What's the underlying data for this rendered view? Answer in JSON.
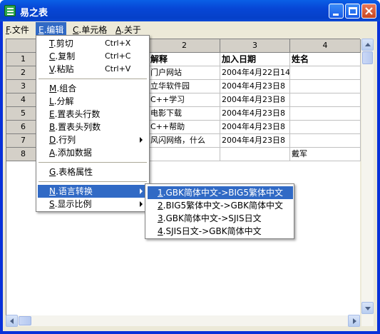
{
  "window": {
    "title": "易之表"
  },
  "menubar": [
    {
      "key": "F",
      "label": "文件"
    },
    {
      "key": "E",
      "label": "编辑"
    },
    {
      "key": "C",
      "label": "单元格"
    },
    {
      "key": "A",
      "label": "关于"
    }
  ],
  "grid": {
    "column_headers": [
      "2",
      "3",
      "4"
    ],
    "row_headers": [
      "1",
      "2",
      "3",
      "4",
      "5",
      "6",
      "7",
      "8"
    ],
    "rows": [
      [
        "解释",
        "加入日期",
        "姓名"
      ],
      [
        "门户网站",
        "2004年4月22日14",
        ""
      ],
      [
        "立华软件园",
        "2004年4月23日8",
        ""
      ],
      [
        "C++学习",
        "2004年4月23日8",
        ""
      ],
      [
        "电影下载",
        "2004年4月23日8",
        ""
      ],
      [
        "C++帮助",
        "2004年4月23日8",
        ""
      ],
      [
        "风闪网络，什么",
        "2004年4月23日8",
        ""
      ],
      [
        "",
        "",
        "戴军"
      ]
    ]
  },
  "edit_menu": {
    "items": [
      {
        "key": "T",
        "label": "剪切",
        "shortcut": "Ctrl+X"
      },
      {
        "key": "C",
        "label": "复制",
        "shortcut": "Ctrl+C"
      },
      {
        "key": "V",
        "label": "粘贴",
        "shortcut": "Ctrl+V"
      },
      {
        "key": "M",
        "label": "组合"
      },
      {
        "key": "L",
        "label": "分解"
      },
      {
        "key": "E",
        "label": "置表头行数"
      },
      {
        "key": "B",
        "label": "置表头列数"
      },
      {
        "key": "D",
        "label": "行列"
      },
      {
        "key": "A",
        "label": "添加数据"
      },
      {
        "key": "G",
        "label": "表格属性"
      },
      {
        "key": "N",
        "label": "语言转换"
      },
      {
        "key": "S",
        "label": "显示比例"
      }
    ]
  },
  "language_submenu": {
    "items": [
      {
        "key": "1",
        "label": "GBK简体中文->BIG5繁体中文"
      },
      {
        "key": "2",
        "label": "BIG5繁体中文->GBK简体中文"
      },
      {
        "key": "3",
        "label": "GBK简体中文->SJIS日文"
      },
      {
        "key": "4",
        "label": "SJIS日文->GBK简体中文"
      }
    ]
  },
  "colors": {
    "highlight": "#316ac5",
    "titlebar": "#0746d6",
    "face": "#ece9d8"
  }
}
